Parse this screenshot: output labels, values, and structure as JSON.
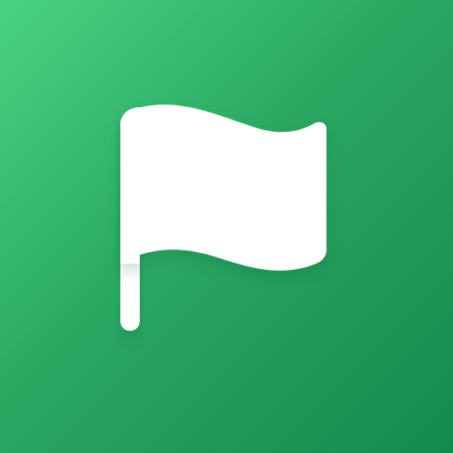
{
  "icon": {
    "name": "flag-icon",
    "colors": {
      "background_top_left": "#49d381",
      "background_bottom_right": "#148a4d",
      "glyph": "#ffffff"
    }
  }
}
